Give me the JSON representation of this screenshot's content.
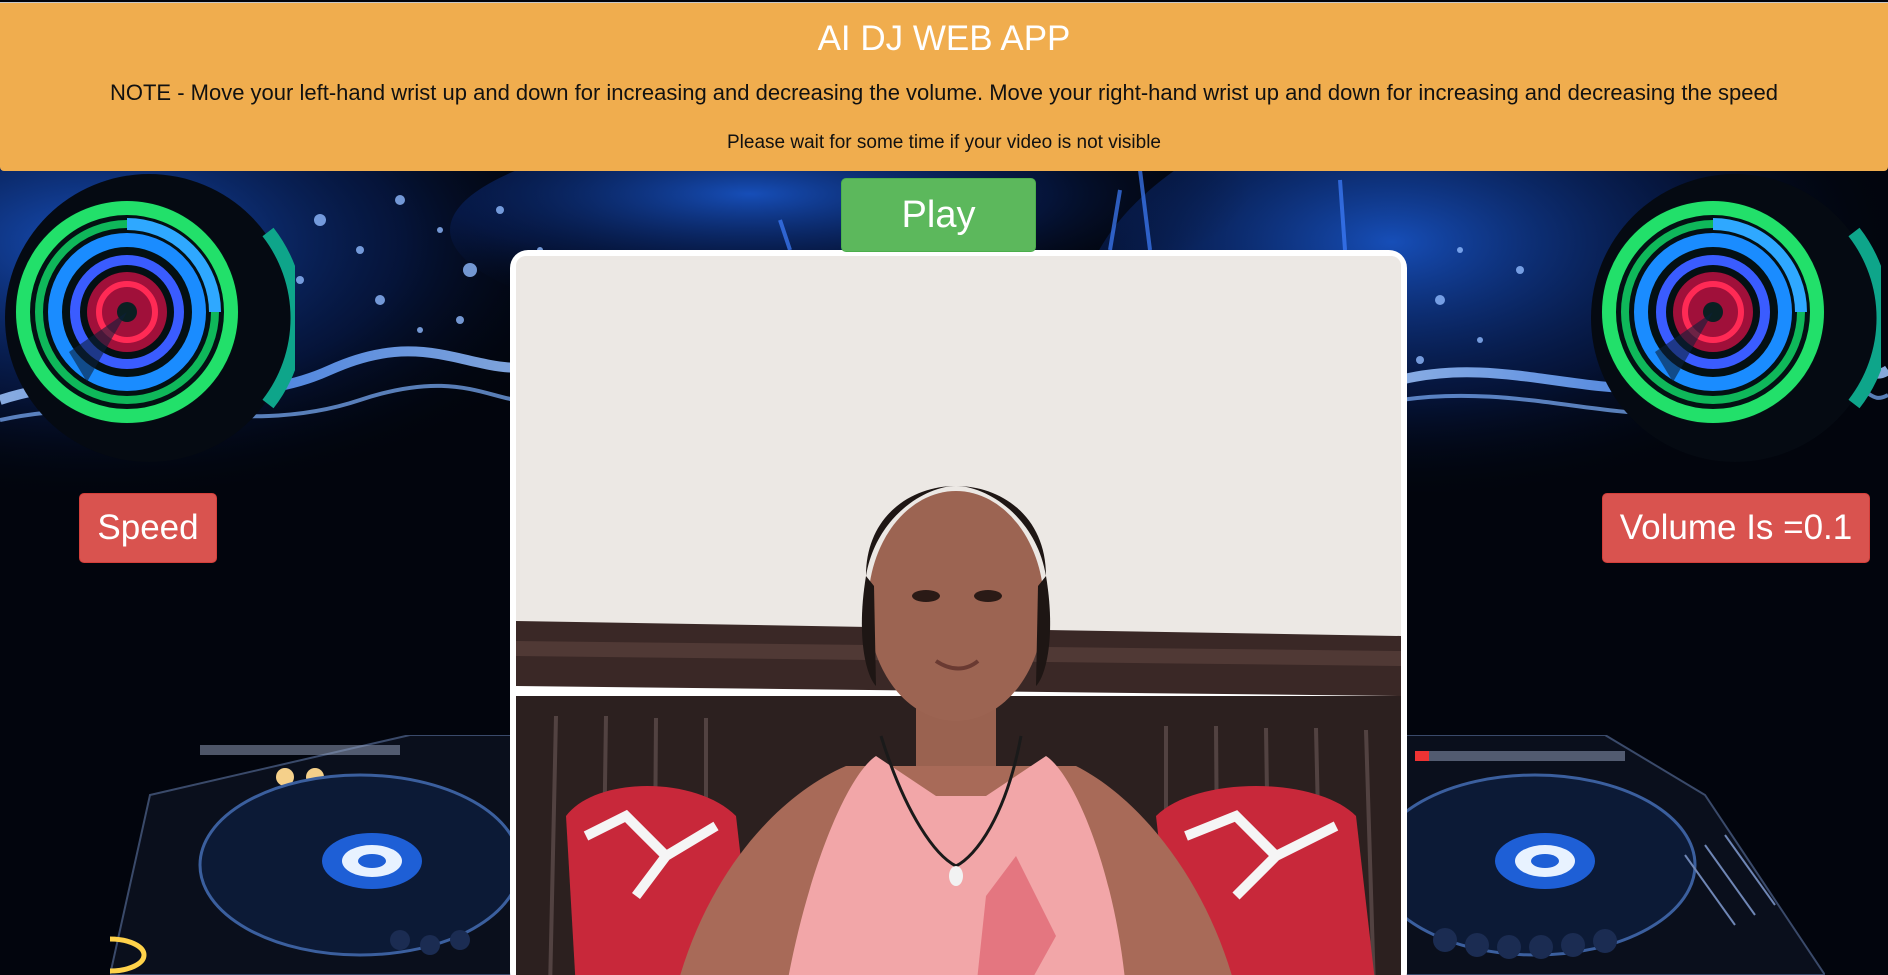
{
  "header": {
    "title": "AI DJ WEB APP",
    "note": "NOTE - Move your left-hand wrist up and down for increasing and decreasing the volume. Move your right-hand wrist up and down for increasing and decreasing the speed",
    "wait_message": "Please wait for some time if your video is not visible"
  },
  "controls": {
    "play_label": "Play",
    "speed_label": "Speed",
    "volume_label": "Volume Is =0.1"
  },
  "colors": {
    "header_bg": "#f0ad4e",
    "play_button": "#5cb85c",
    "status_buttons": "#d9534f",
    "background": "#02050d"
  },
  "icons": {
    "left_disc": "neon-speaker-disc-icon",
    "right_disc": "neon-speaker-disc-icon",
    "left_deck": "dj-turntable-icon",
    "right_deck": "dj-turntable-icon"
  }
}
